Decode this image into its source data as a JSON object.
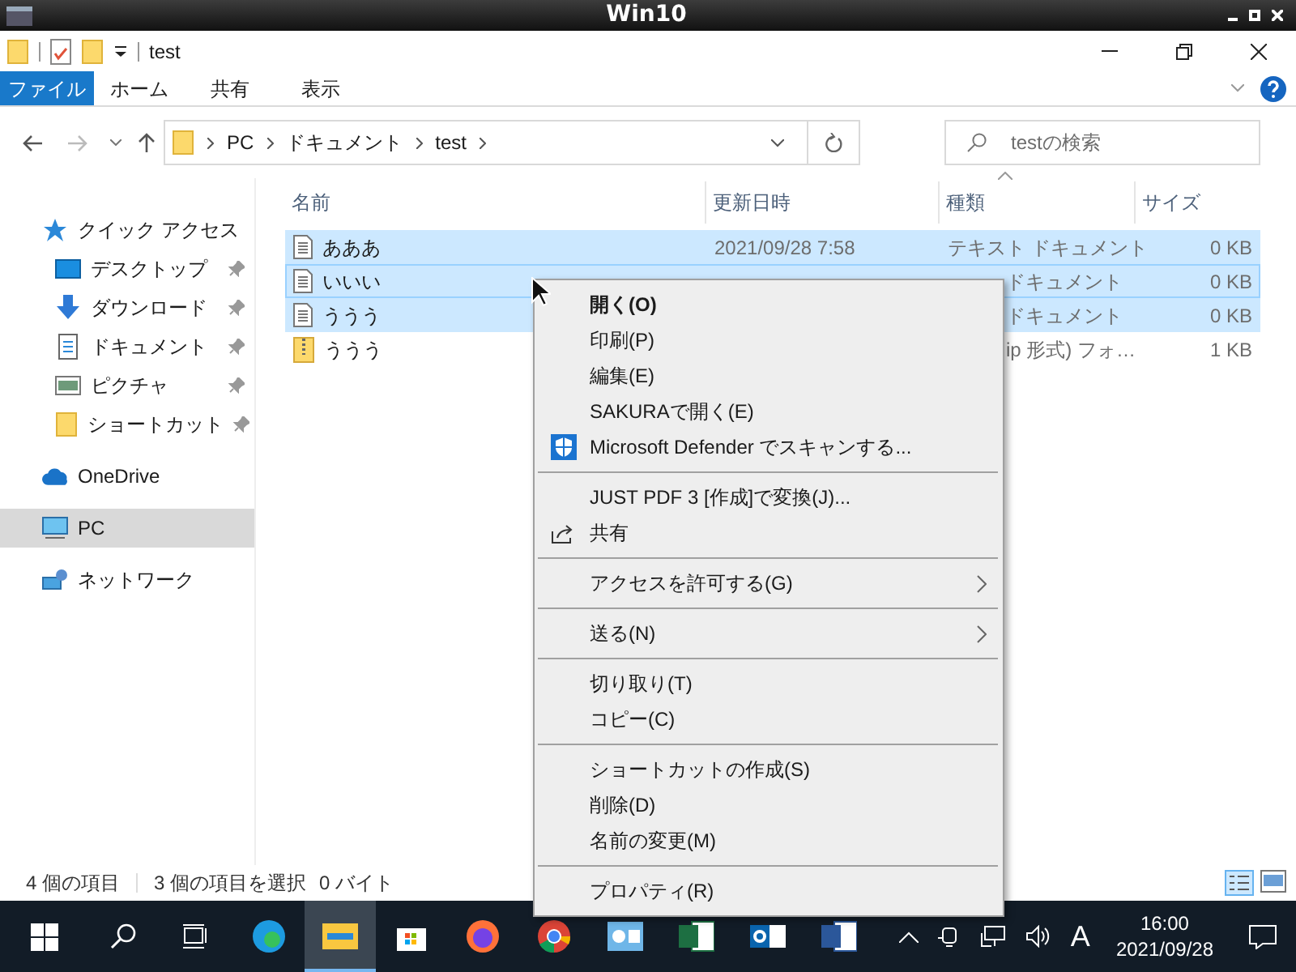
{
  "window": {
    "title": "Win10"
  },
  "quick_access_toolbar": {
    "title": "test"
  },
  "ribbon_tabs": [
    {
      "label": "ファイル",
      "selected": true
    },
    {
      "label": "ホーム",
      "selected": false
    },
    {
      "label": "共有",
      "selected": false
    },
    {
      "label": "表示",
      "selected": false
    }
  ],
  "address_bar": {
    "path": [
      "PC",
      "ドキュメント",
      "test"
    ]
  },
  "search": {
    "placeholder": "testの検索"
  },
  "nav": {
    "items": [
      {
        "label": "クイック アクセス",
        "kind": "group",
        "selected": false
      },
      {
        "label": "デスクトップ",
        "kind": "pinned",
        "selected": false
      },
      {
        "label": "ダウンロード",
        "kind": "pinned",
        "selected": false
      },
      {
        "label": "ドキュメント",
        "kind": "pinned",
        "selected": false
      },
      {
        "label": "ピクチャ",
        "kind": "pinned",
        "selected": false
      },
      {
        "label": "ショートカット",
        "kind": "pinned",
        "selected": false
      },
      {
        "label": "OneDrive",
        "kind": "group",
        "selected": false
      },
      {
        "label": "PC",
        "kind": "group",
        "selected": true
      },
      {
        "label": "ネットワーク",
        "kind": "group",
        "selected": false
      }
    ]
  },
  "columns": [
    "名前",
    "更新日時",
    "種類",
    "サイズ"
  ],
  "rows": [
    {
      "name": "あああ",
      "modified": "2021/09/28 7:58",
      "type": "テキスト ドキュメント",
      "size": "0 KB",
      "selected": true,
      "focused": false,
      "covered": false,
      "kind": "text"
    },
    {
      "name": "いいい",
      "type": "ドキュメント",
      "size": "0 KB",
      "selected": true,
      "focused": true,
      "covered": true,
      "kind": "text"
    },
    {
      "name": "ううう",
      "type": "ドキュメント",
      "size": "0 KB",
      "selected": true,
      "focused": false,
      "covered": true,
      "kind": "text"
    },
    {
      "name": "ううう",
      "type": "ip 形式) フォ…",
      "size": "1 KB",
      "selected": false,
      "focused": false,
      "covered": true,
      "kind": "zip"
    }
  ],
  "context_menu": {
    "items": [
      {
        "kind": "item",
        "label": "開く(O)",
        "default": true
      },
      {
        "kind": "item",
        "label": "印刷(P)",
        "default": false
      },
      {
        "kind": "item",
        "label": "編集(E)",
        "default": false
      },
      {
        "kind": "item",
        "label": "SAKURAで開く(E)",
        "default": false
      },
      {
        "kind": "item",
        "label": "Microsoft Defender でスキャンする...",
        "default": false
      },
      {
        "kind": "separator"
      },
      {
        "kind": "item",
        "label": "JUST PDF 3 [作成]で変換(J)...",
        "default": false
      },
      {
        "kind": "item",
        "label": "共有",
        "default": false
      },
      {
        "kind": "separator"
      },
      {
        "kind": "submenu",
        "label": "アクセスを許可する(G)",
        "default": false
      },
      {
        "kind": "separator"
      },
      {
        "kind": "submenu",
        "label": "送る(N)",
        "default": false
      },
      {
        "kind": "separator"
      },
      {
        "kind": "item",
        "label": "切り取り(T)",
        "default": false
      },
      {
        "kind": "item",
        "label": "コピー(C)",
        "default": false
      },
      {
        "kind": "separator"
      },
      {
        "kind": "item",
        "label": "ショートカットの作成(S)",
        "default": false
      },
      {
        "kind": "item",
        "label": "削除(D)",
        "default": false
      },
      {
        "kind": "item",
        "label": "名前の変更(M)",
        "default": false
      },
      {
        "kind": "separator"
      },
      {
        "kind": "item",
        "label": "プロパティ(R)",
        "default": false
      }
    ]
  },
  "status_bar": {
    "item_count": "4 個の項目",
    "selection": "3 個の項目を選択",
    "size": "0 バイト"
  },
  "taskbar": {
    "apps": [
      {
        "selected": false
      },
      {
        "selected": true
      },
      {
        "selected": false
      },
      {
        "selected": false
      },
      {
        "selected": false
      },
      {
        "selected": false
      },
      {
        "selected": false
      },
      {
        "selected": false
      },
      {
        "selected": false
      }
    ],
    "ime": "A",
    "time": "16:00",
    "date": "2021/09/28"
  }
}
